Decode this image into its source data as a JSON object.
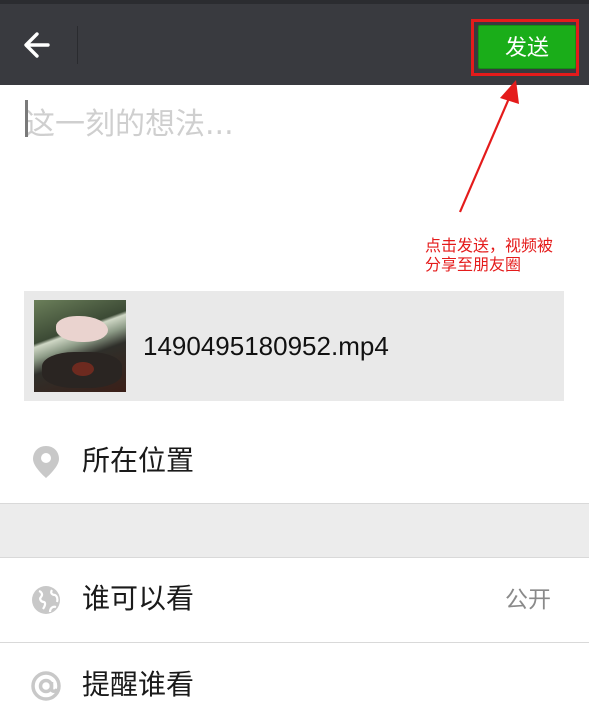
{
  "header": {
    "send_label": "发送"
  },
  "composer": {
    "placeholder": "这一刻的想法..."
  },
  "annotation": {
    "line1": "点击发送，视频被",
    "line2": "分享至朋友圈"
  },
  "attachment": {
    "file_name": "1490495180952.mp4"
  },
  "options": {
    "location_label": "所在位置",
    "visibility_label": "谁可以看",
    "visibility_value": "公开",
    "remind_label": "提醒谁看"
  },
  "colors": {
    "header_bg": "#393a3f",
    "send_green": "#1aad19",
    "annotation_red": "#e41b1b"
  },
  "icons": [
    "back-arrow-icon",
    "location-pin-icon",
    "globe-icon",
    "at-sign-icon"
  ]
}
